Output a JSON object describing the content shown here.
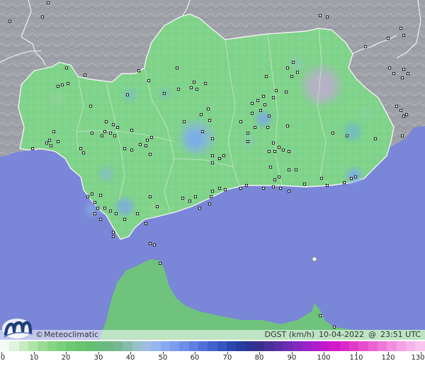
{
  "map": {
    "credit": "Meteoclimatic",
    "copyright_symbol": "©",
    "variable_label": "DGST (km/h)",
    "date": "10-04-2022",
    "at_symbol": "@",
    "time": "23:51 UTC",
    "logo_icon": "meteoclimatic-logo-icon",
    "colors": {
      "sea": "#7a86d8",
      "land_outside_region": "#a0a2aa",
      "region_base": "#7fd48a",
      "region_border": "#f0f0f0",
      "station_marker": "#111111"
    }
  },
  "legend": {
    "ticks": [
      "0",
      "10",
      "20",
      "30",
      "40",
      "50",
      "60",
      "70",
      "80",
      "90",
      "100",
      "110",
      "120",
      "130"
    ],
    "min": 0,
    "max": 130,
    "colors": [
      "#f4fbf4",
      "#dff4dc",
      "#c6ecc2",
      "#aee4aa",
      "#98dc94",
      "#86d683",
      "#78d07a",
      "#6ccb72",
      "#66c56e",
      "#64c070",
      "#66bc78",
      "#6cb884",
      "#76b890",
      "#86bcaa",
      "#98c2c8",
      "#a0bde0",
      "#96b4ee",
      "#8aa8f0",
      "#7c9cee",
      "#6e8ee8",
      "#5f80e2",
      "#5070d8",
      "#4262cc",
      "#3654be",
      "#2c46b0",
      "#263ca0",
      "#2a3492",
      "#38308e",
      "#48309a",
      "#5a2ea6",
      "#6e2cb4",
      "#8428c0",
      "#9a22c8",
      "#b01ccc",
      "#c418cc",
      "#d21ac8",
      "#dc28c8",
      "#e23ac8",
      "#e64ccc",
      "#ea62d2",
      "#ee78d8",
      "#f28ede",
      "#f4a2e4",
      "#f6b4ea",
      "#f8c4ee"
    ]
  }
}
